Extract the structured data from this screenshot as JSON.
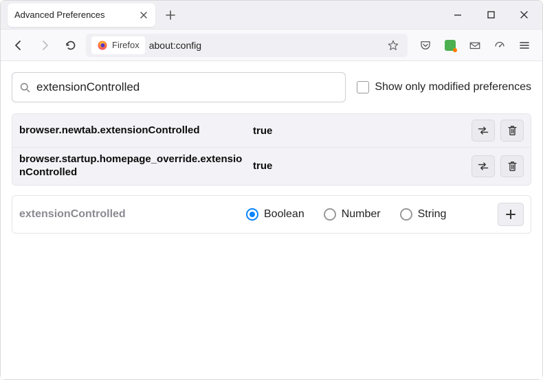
{
  "window": {
    "tab_title": "Advanced Preferences"
  },
  "toolbar": {
    "identity_label": "Firefox",
    "url": "about:config"
  },
  "search": {
    "value": "extensionControlled",
    "modified_only_label": "Show only modified preferences",
    "modified_only_checked": false
  },
  "prefs": [
    {
      "name": "browser.newtab.extensionControlled",
      "value": "true"
    },
    {
      "name": "browser.startup.homepage_override.extensionControlled",
      "value": "true"
    }
  ],
  "new_pref": {
    "name": "extensionControlled",
    "types": [
      "Boolean",
      "Number",
      "String"
    ],
    "selected_type": "Boolean"
  }
}
